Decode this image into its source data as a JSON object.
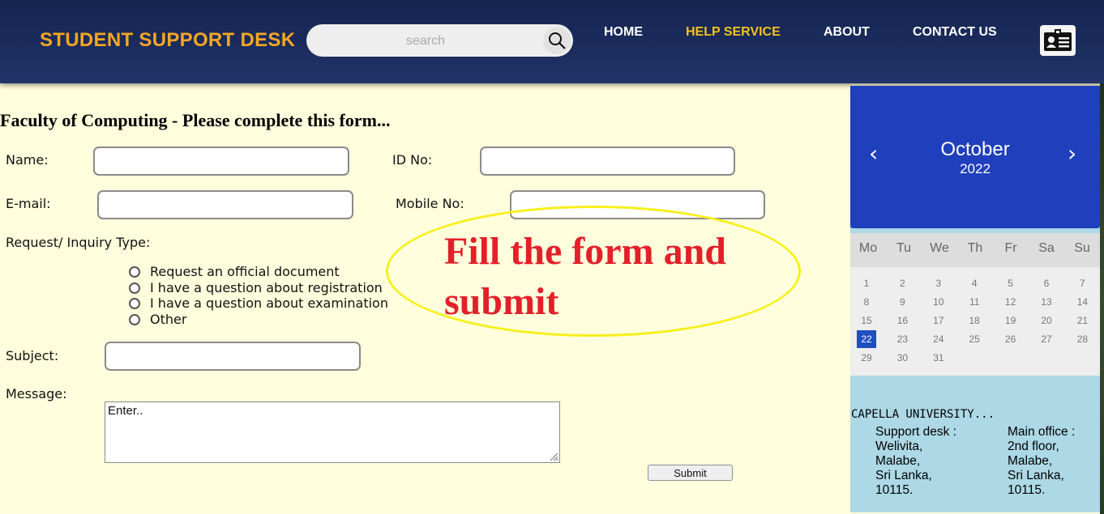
{
  "header": {
    "brand": "STUDENT SUPPORT DESK",
    "search_placeholder": "search",
    "nav": [
      {
        "label": "HOME"
      },
      {
        "label": "HELP SERVICE"
      },
      {
        "label": "ABOUT"
      },
      {
        "label": "CONTACT US"
      }
    ],
    "active_nav": "HELP SERVICE",
    "icons": {
      "search": "search-icon",
      "profile": "id-card-icon"
    }
  },
  "form": {
    "title": "Faculty of Computing - Please complete this form...",
    "name_label": "Name:",
    "id_label": "ID No:",
    "email_label": "E-mail:",
    "mobile_label": "Mobile No:",
    "request_label": "Request/ Inquiry Type:",
    "options": [
      "Request an official document",
      "I have a question about registration",
      "I have a question about examination",
      "Other"
    ],
    "subject_label": "Subject:",
    "message_label": "Message:",
    "message_value": "Enter..",
    "submit_label": "Submit"
  },
  "annotation": {
    "line1": "Fill the form and",
    "line2": "submit"
  },
  "calendar": {
    "month": "October",
    "year": "2022",
    "prev": "‹",
    "next": "›",
    "weekdays": [
      "Mo",
      "Tu",
      "We",
      "Th",
      "Fr",
      "Sa",
      "Su"
    ],
    "days": [
      "1",
      "2",
      "3",
      "4",
      "5",
      "6",
      "7",
      "8",
      "9",
      "10",
      "11",
      "12",
      "13",
      "14",
      "15",
      "16",
      "17",
      "18",
      "19",
      "20",
      "21",
      "22",
      "23",
      "24",
      "25",
      "26",
      "27",
      "28",
      "29",
      "30",
      "31"
    ],
    "selected_day": "22"
  },
  "address": {
    "title": "CAPELLA UNIVERSITY...",
    "support": [
      "Support desk :",
      "Welivita,",
      "Malabe,",
      "Sri Lanka,",
      "10115."
    ],
    "main": [
      "Main office :",
      "2nd floor,",
      "Malabe,",
      "Sri Lanka,",
      "10115."
    ]
  },
  "colors": {
    "header_bg": "#1b2c5e",
    "brand": "#f5a623",
    "nav_active": "#f2c31a",
    "page_bg": "#ffffdd",
    "calendar_head": "#1f3fbd",
    "annotation_text": "#e3202a",
    "annotation_ellipse": "#f7f01c"
  }
}
